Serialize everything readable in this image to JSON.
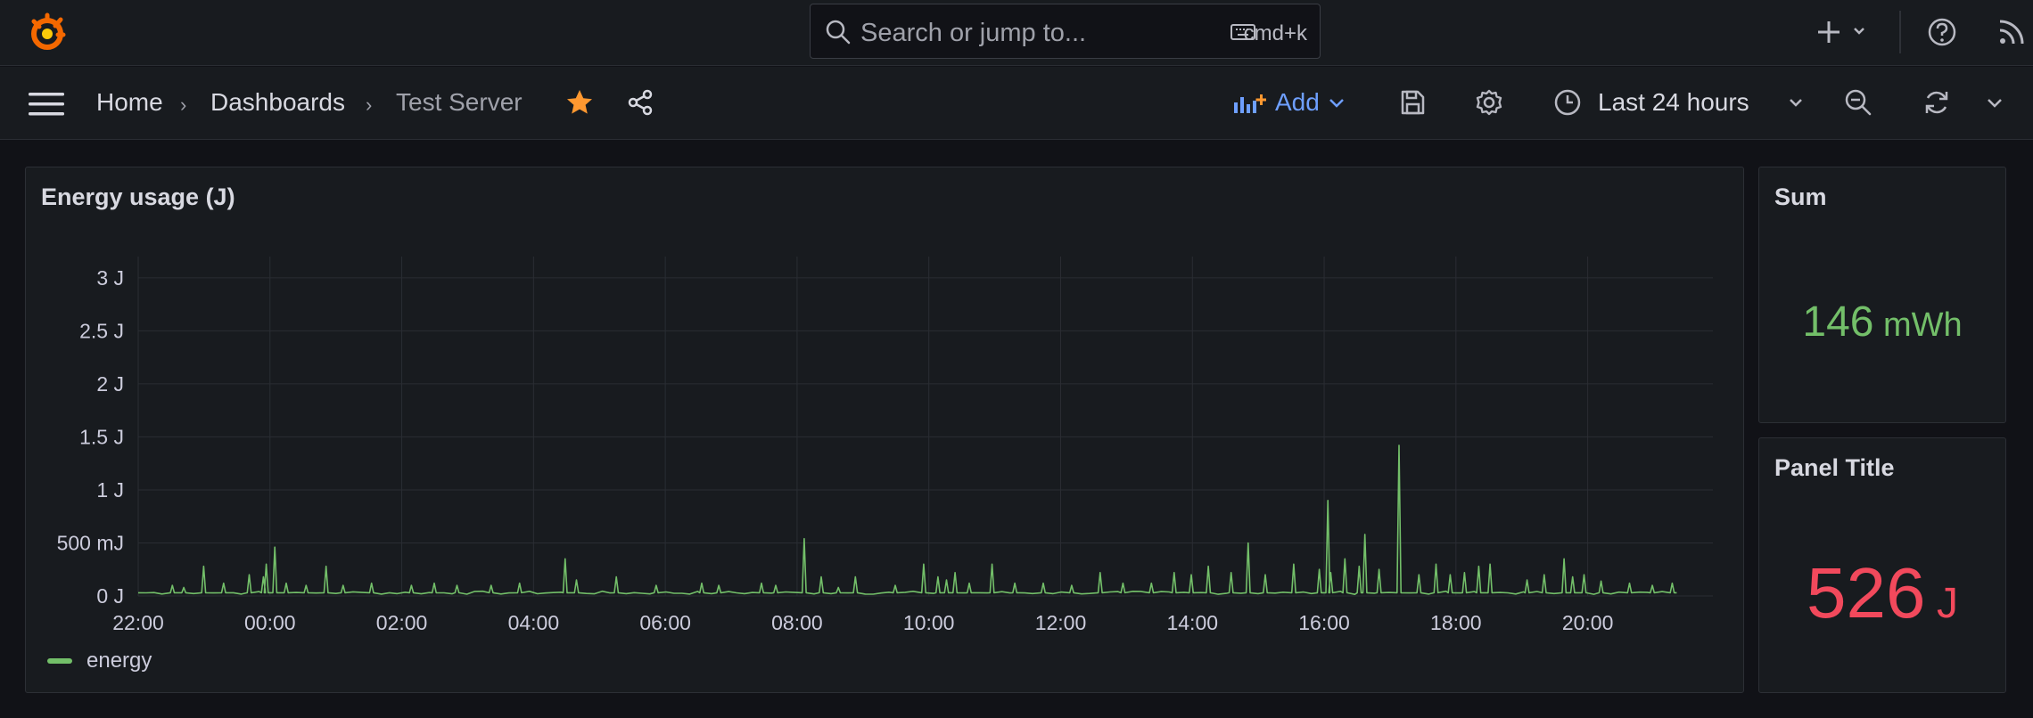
{
  "search": {
    "placeholder": "Search or jump to...",
    "shortcut": "cmd+k"
  },
  "breadcrumb": {
    "home": "Home",
    "dashboards": "Dashboards",
    "current": "Test Server"
  },
  "toolbar": {
    "add_label": "Add",
    "time_range": "Last 24 hours"
  },
  "colors": {
    "series": "#73bf69",
    "sum_value": "#73bf69",
    "panel_value": "#f2495c",
    "star": "#ff9830",
    "add_accent": "#6e9fff"
  },
  "panels": {
    "energy": {
      "title": "Energy usage (J)",
      "legend": "energy"
    },
    "sum": {
      "title": "Sum",
      "value": "146",
      "unit": "mWh"
    },
    "panel2": {
      "title": "Panel Title",
      "value": "526",
      "unit": "J"
    }
  },
  "chart_data": {
    "type": "line",
    "title": "Energy usage (J)",
    "y_ticks": [
      "0 J",
      "500 mJ",
      "1 J",
      "1.5 J",
      "2 J",
      "2.5 J",
      "3 J"
    ],
    "ylim": [
      0,
      3.2
    ],
    "x_ticks": [
      "22:00",
      "00:00",
      "02:00",
      "04:00",
      "06:00",
      "08:00",
      "10:00",
      "12:00",
      "14:00",
      "16:00",
      "18:00",
      "20:00"
    ],
    "xlim_hours": [
      0,
      23.9
    ],
    "x_end_hours": 23.35,
    "baseline_j": 0.03,
    "grid": true,
    "legend_position": "bottom-left",
    "series": [
      {
        "name": "energy",
        "spikes": [
          [
            0.6,
            0.1
          ],
          [
            0.8,
            0.08
          ],
          [
            1.15,
            0.28
          ],
          [
            1.5,
            0.12
          ],
          [
            1.95,
            0.2
          ],
          [
            2.2,
            0.18
          ],
          [
            2.25,
            0.3
          ],
          [
            2.4,
            0.46
          ],
          [
            2.6,
            0.12
          ],
          [
            2.95,
            0.1
          ],
          [
            3.3,
            0.28
          ],
          [
            3.6,
            0.1
          ],
          [
            4.1,
            0.12
          ],
          [
            4.8,
            0.1
          ],
          [
            5.2,
            0.12
          ],
          [
            5.6,
            0.1
          ],
          [
            6.2,
            0.1
          ],
          [
            6.7,
            0.12
          ],
          [
            7.5,
            0.35
          ],
          [
            7.7,
            0.15
          ],
          [
            8.4,
            0.18
          ],
          [
            9.1,
            0.1
          ],
          [
            9.9,
            0.12
          ],
          [
            10.2,
            0.1
          ],
          [
            10.95,
            0.12
          ],
          [
            11.2,
            0.1
          ],
          [
            11.7,
            0.54
          ],
          [
            12.0,
            0.18
          ],
          [
            12.3,
            0.08
          ],
          [
            12.6,
            0.18
          ],
          [
            13.3,
            0.1
          ],
          [
            13.8,
            0.3
          ],
          [
            14.05,
            0.18
          ],
          [
            14.2,
            0.15
          ],
          [
            14.35,
            0.22
          ],
          [
            14.6,
            0.12
          ],
          [
            15.0,
            0.3
          ],
          [
            15.4,
            0.12
          ],
          [
            15.9,
            0.12
          ],
          [
            16.4,
            0.1
          ],
          [
            16.9,
            0.22
          ],
          [
            17.3,
            0.12
          ],
          [
            17.8,
            0.12
          ],
          [
            18.2,
            0.22
          ],
          [
            18.5,
            0.2
          ],
          [
            18.8,
            0.28
          ],
          [
            19.2,
            0.22
          ],
          [
            19.5,
            0.5
          ],
          [
            19.8,
            0.2
          ],
          [
            20.3,
            0.3
          ],
          [
            20.75,
            0.25
          ],
          [
            20.9,
            0.9
          ],
          [
            20.95,
            0.22
          ],
          [
            21.2,
            0.35
          ],
          [
            21.45,
            0.28
          ],
          [
            21.55,
            0.58
          ],
          [
            21.8,
            0.25
          ],
          [
            22.15,
            1.42
          ],
          [
            22.5,
            0.2
          ],
          [
            22.8,
            0.3
          ],
          [
            23.05,
            0.2
          ],
          [
            23.3,
            0.22
          ],
          [
            23.55,
            0.28
          ],
          [
            23.75,
            0.3
          ],
          [
            24.4,
            0.15
          ],
          [
            24.7,
            0.2
          ],
          [
            25.05,
            0.35
          ],
          [
            25.2,
            0.18
          ],
          [
            25.4,
            0.2
          ],
          [
            25.7,
            0.14
          ],
          [
            26.2,
            0.12
          ],
          [
            26.6,
            0.1
          ],
          [
            26.95,
            0.12
          ]
        ]
      }
    ]
  }
}
